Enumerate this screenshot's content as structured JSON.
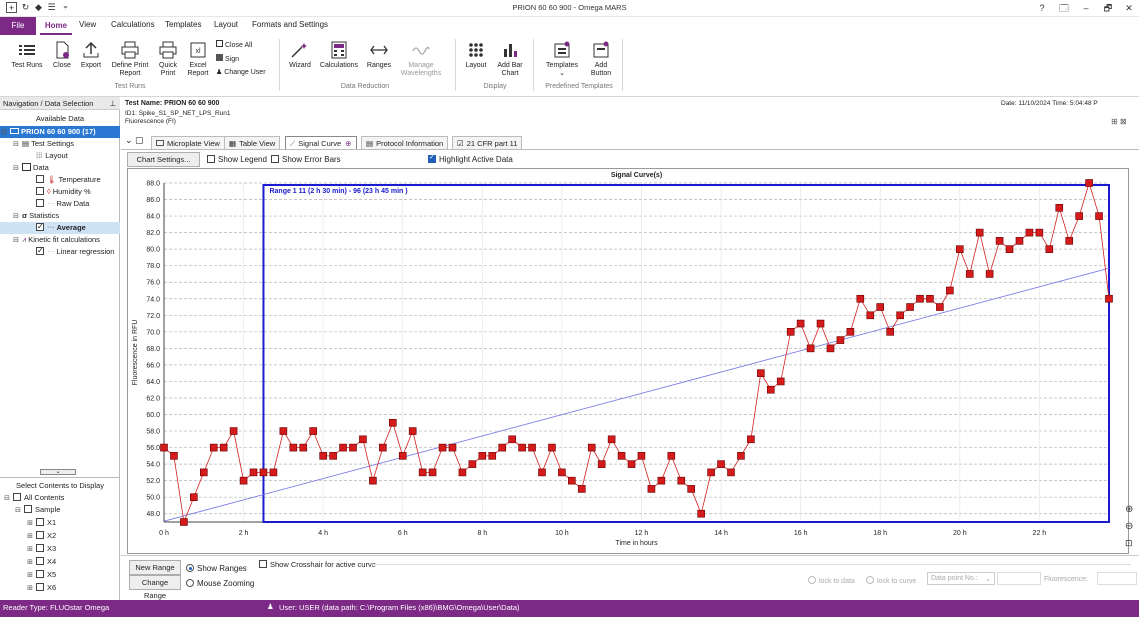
{
  "window": {
    "title": "PRION 60 60 900 - Omega MARS",
    "help": "?",
    "restore": "🗔",
    "minimize": "–",
    "maximize": "🗗",
    "close": "✕"
  },
  "menu": {
    "file": "File",
    "home": "Home",
    "view": "View",
    "calculations": "Calculations",
    "templates": "Templates",
    "layout": "Layout",
    "formats": "Formats and Settings"
  },
  "ribbon": {
    "test_runs": "Test Runs",
    "close": "Close",
    "export": "Export",
    "define_print_1": "Define Print",
    "define_print_2": "Report",
    "quick_1": "Quick",
    "quick_2": "Print",
    "excel_1": "Excel",
    "excel_2": "Report",
    "close_all": "Close All",
    "sign": "Sign",
    "change_user": "Change User",
    "group_test_runs": "Test Runs",
    "wizard": "Wizard",
    "calculations": "Calculations",
    "ranges": "Ranges",
    "manage_1": "Manage",
    "manage_2": "Wavelengths",
    "group_data_reduction": "Data Reduction",
    "layout": "Layout",
    "add_bar_1": "Add Bar",
    "add_bar_2": "Chart",
    "group_display": "Display",
    "templates": "Templates",
    "add_button_1": "Add",
    "add_button_2": "Button",
    "group_predefined": "Predefined Templates"
  },
  "nav": {
    "header": "Navigation / Data Selection",
    "available": "Available Data",
    "root": "PRION 60 60 900 (17)",
    "test_settings": "Test Settings",
    "layout": "Layout",
    "data": "Data",
    "temperature": "Temperature",
    "humidity": "Humidity %",
    "raw": "Raw Data",
    "statistics": "Statistics",
    "average": "Average",
    "kinetic": "Kinetic fit calculations",
    "linear": "Linear regression",
    "select_header": "Select Contents to Display",
    "all_contents": "All Contents",
    "sample": "Sample",
    "samples": [
      "X1",
      "X2",
      "X3",
      "X4",
      "X5",
      "X6"
    ]
  },
  "header": {
    "test_name": "Test Name: PRION 60 60 900",
    "id1": "ID1: Spike_S1_SP_NET_LPS_Run1",
    "mode": "Fluorescence (FI)",
    "date": "Date: 11/10/2024  Time: 5:04:48 P"
  },
  "tabs": [
    "Microplate View",
    "Table View",
    "Signal Curve",
    "Protocol Information",
    "21 CFR part 11"
  ],
  "toolbar": {
    "chart_settings": "Chart Settings...",
    "show_legend": "Show Legend",
    "show_error_bars": "Show Error Bars",
    "highlight": "Highlight Active Data"
  },
  "bottom": {
    "new_range": "New Range",
    "change_range": "Change Range",
    "show_ranges": "Show Ranges",
    "mouse_zooming": "Mouse Zooming",
    "crosshair": "Show Crosshair for active curve",
    "lock_data": "lock to data",
    "lock_curve": "lock to curve",
    "data_point": "Data point No.:",
    "fluorescence": "Fluorescence:"
  },
  "status": {
    "reader": "Reader Type: FLUOstar Omega",
    "user": "User: USER  (data path: C:\\Program Files (x86)\\BMG\\Omega\\User\\Data)"
  },
  "colors": {
    "accent": "#7d2a86",
    "series": "#d42020",
    "range": "#1a1ad0",
    "fit": "#7a7ae6"
  },
  "chart_data": {
    "type": "scatter",
    "title": "Signal Curve(s)",
    "xlabel": "Time in hours",
    "ylabel": "Fluorescence in RFU",
    "ylim": [
      47,
      88
    ],
    "xlim": [
      0,
      23.75
    ],
    "y_ticks": [
      "48.0",
      "50.0",
      "52.0",
      "54.0",
      "56.0",
      "58.0",
      "60.0",
      "62.0",
      "64.0",
      "66.0",
      "68.0",
      "70.0",
      "72.0",
      "74.0",
      "76.0",
      "78.0",
      "80.0",
      "82.0",
      "84.0",
      "86.0",
      "88.0"
    ],
    "x_ticks": [
      "0 h",
      "2 h",
      "4 h",
      "6 h",
      "8 h",
      "10 h",
      "12 h",
      "14 h",
      "16 h",
      "18 h",
      "20 h",
      "22 h"
    ],
    "range_label": "Range 1 11 (2 h 30 min) - 96 (23 h 45 min )",
    "range_x": [
      2.5,
      23.75
    ],
    "grid": true,
    "legend": false,
    "series": [
      {
        "values": [
          56,
          55,
          47,
          50,
          53,
          56,
          56,
          58,
          52,
          53,
          53,
          53,
          58,
          56,
          56,
          58,
          55,
          55,
          56,
          56,
          57,
          52,
          56,
          59,
          55,
          58,
          53,
          53,
          56,
          56,
          53,
          54,
          55,
          55,
          56,
          57,
          56,
          56,
          53,
          56,
          53,
          52,
          51,
          56,
          54,
          57,
          55,
          54,
          55,
          51,
          52,
          55,
          52,
          51,
          48,
          53,
          54,
          53,
          55,
          57,
          65,
          63,
          64,
          70,
          71,
          68,
          71,
          68,
          69,
          70,
          74,
          72,
          73,
          70,
          72,
          73,
          74,
          74,
          73,
          75,
          80,
          77,
          82,
          77,
          81,
          80,
          81,
          82,
          82,
          80,
          85,
          81,
          84,
          88,
          84,
          74
        ]
      }
    ],
    "fit": {
      "x": [
        0,
        23.75
      ],
      "y": [
        47.1,
        77.7
      ]
    }
  }
}
